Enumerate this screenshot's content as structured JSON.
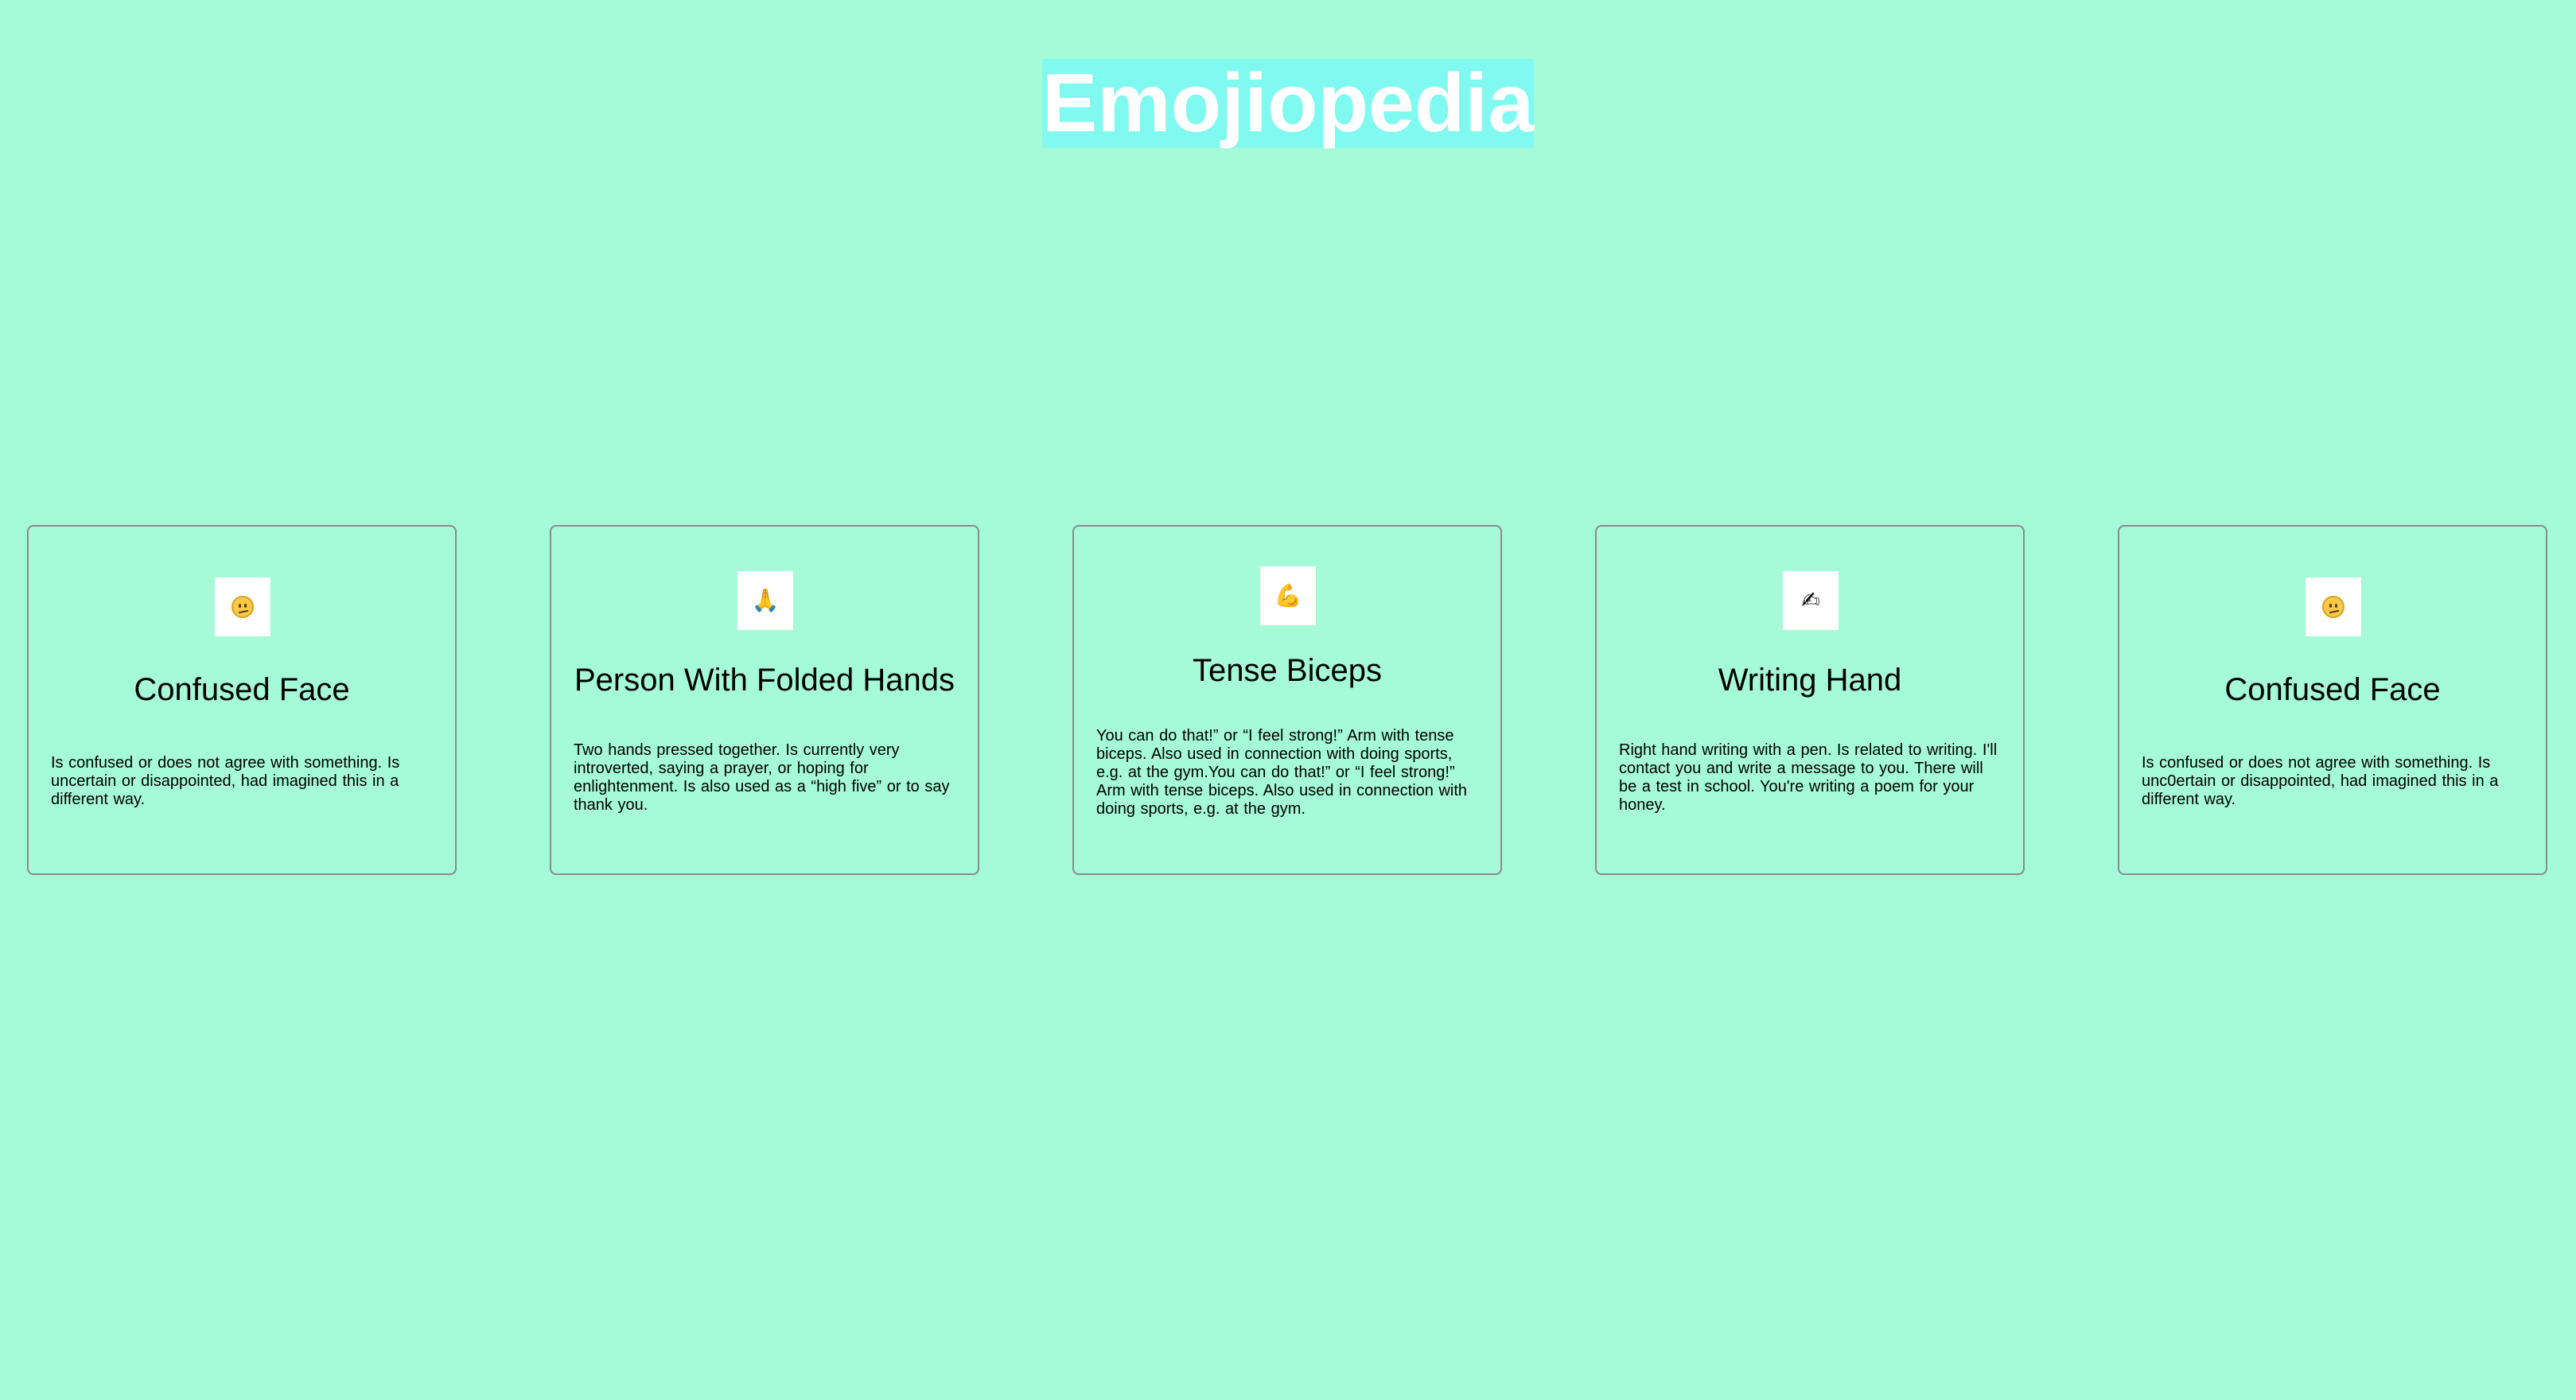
{
  "header": {
    "title": "Emojiopedia"
  },
  "cards": [
    {
      "emoji": "😕",
      "icon": "confused-face-icon",
      "title": "Confused Face",
      "description": "Is confused or does not agree with something. Is uncertain or disappointed, had imagined this in a different way."
    },
    {
      "emoji": "🙏",
      "icon": "folded-hands-icon",
      "title": "Person With Folded Hands",
      "description": "Two hands pressed together. Is currently very introverted, saying a prayer, or hoping for enlightenment. Is also used as a “high five” or to say thank you."
    },
    {
      "emoji": "💪",
      "icon": "flexed-biceps-icon",
      "title": "Tense Biceps",
      "description": "You can do that!” or “I feel strong!” Arm with tense biceps. Also used in connection with doing sports, e.g. at the gym.You can do that!” or “I feel strong!” Arm with tense biceps. Also used in connection with doing sports, e.g. at the gym."
    },
    {
      "emoji": "✍",
      "icon": "writing-hand-icon",
      "title": "Writing Hand",
      "description": "Right hand writing with a pen. Is related to writing. I'll contact you and write a message to you. There will be a test in school. You're writing a poem for your honey."
    },
    {
      "emoji": "😕",
      "icon": "confused-face-icon",
      "title": "Confused Face",
      "description": "Is confused or does not agree with something. Is unc0ertain or disappointed, had imagined this in a different way."
    }
  ]
}
